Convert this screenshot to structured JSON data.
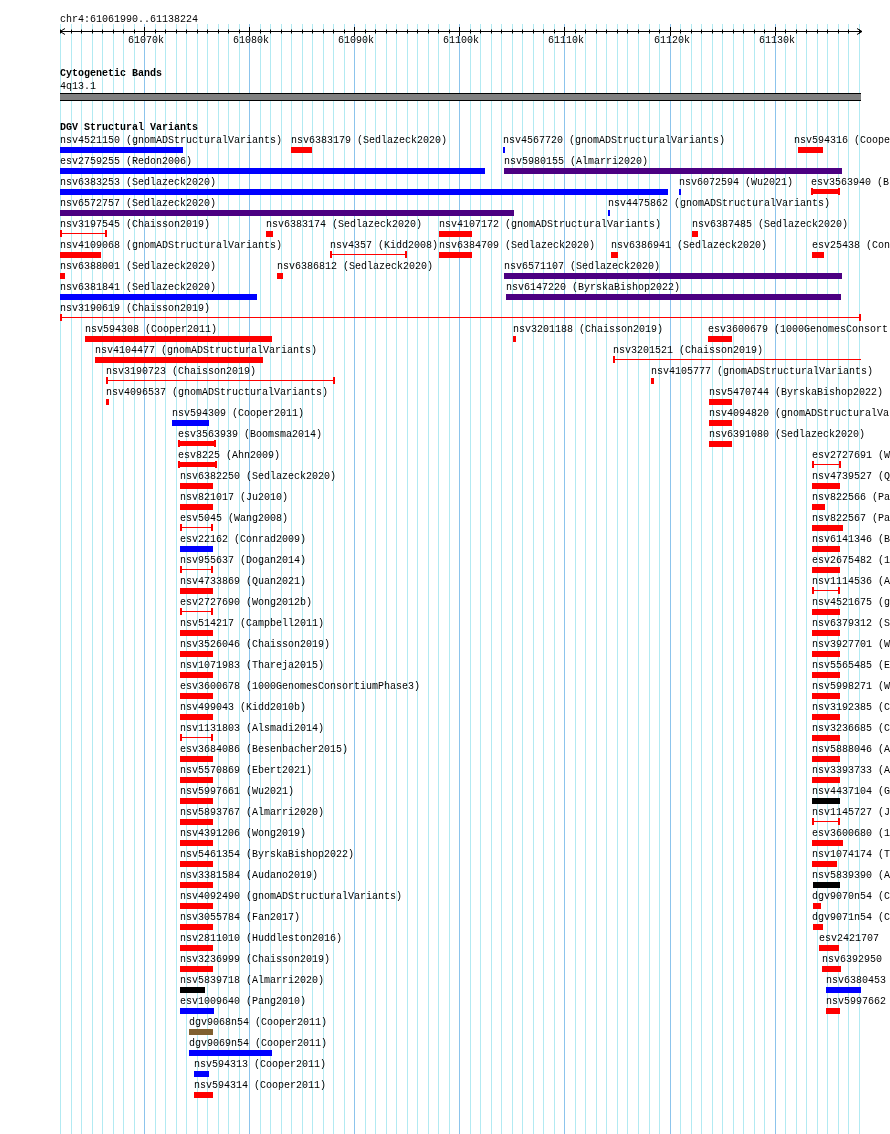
{
  "ruler": {
    "title": "chr4:61061990..61138224",
    "labels": [
      "61070k",
      "61080k",
      "61090k",
      "61100k",
      "61110k",
      "61120k",
      "61130k"
    ]
  },
  "tracks": [
    {
      "title": "Cytogenetic Bands",
      "band": {
        "label": "4q13.1"
      }
    },
    {
      "title": "DGV Structural Variants",
      "features": [
        {
          "label": "nsv4521150 (gnomADStructuralVariants)",
          "kind": "bar",
          "color": "#0000ff"
        },
        {
          "label": "nsv6383179 (Sedlazeck2020)",
          "kind": "bar",
          "color": "#ff0000"
        },
        {
          "label": "nsv4567720 (gnomADStructuralVariants)",
          "kind": "bar",
          "color": "#0000ff"
        },
        {
          "label": "nsv594316 (Coope",
          "kind": "bar",
          "color": "#ff0000"
        },
        {
          "label": "esv2759255 (Redon2006)",
          "kind": "bar",
          "color": "#0000ff"
        },
        {
          "label": "nsv5980155 (Almarri2020)",
          "kind": "bar",
          "color": "#4b0082"
        },
        {
          "label": "nsv6383253 (Sedlazeck2020)",
          "kind": "bar",
          "color": "#0000ff"
        },
        {
          "label": "nsv6072594 (Wu2021)",
          "kind": "bar",
          "color": "#0000ff"
        },
        {
          "label": "esv3563940 (B",
          "kind": "capped",
          "color": "#ff0000"
        },
        {
          "label": "nsv6572757 (Sedlazeck2020)",
          "kind": "bar",
          "color": "#4b0082"
        },
        {
          "label": "nsv4475862 (gnomADStructuralVariants)",
          "kind": "bar",
          "color": "#0000ff"
        },
        {
          "label": "nsv3197545 (Chaisson2019)",
          "kind": "span",
          "color": "#ff0000"
        },
        {
          "label": "nsv6383174 (Sedlazeck2020)",
          "kind": "bar",
          "color": "#ff0000"
        },
        {
          "label": "nsv4107172 (gnomADStructuralVariants)",
          "kind": "bar",
          "color": "#ff0000"
        },
        {
          "label": "nsv6387485 (Sedlazeck2020)",
          "kind": "bar",
          "color": "#ff0000"
        },
        {
          "label": "nsv4109068 (gnomADStructuralVariants)",
          "kind": "bar",
          "color": "#ff0000"
        },
        {
          "label": "nsv4357 (Kidd2008)",
          "kind": "span",
          "color": "#ff0000"
        },
        {
          "label": "nsv6384709 (Sedlazeck2020)",
          "kind": "bar",
          "color": "#ff0000"
        },
        {
          "label": "nsv6386941 (Sedlazeck2020)",
          "kind": "bar",
          "color": "#ff0000"
        },
        {
          "label": "esv25438 (Con",
          "kind": "bar",
          "color": "#ff0000"
        },
        {
          "label": "nsv6388001 (Sedlazeck2020)",
          "kind": "bar",
          "color": "#ff0000"
        },
        {
          "label": "nsv6386812 (Sedlazeck2020)",
          "kind": "bar",
          "color": "#ff0000"
        },
        {
          "label": "nsv6571107 (Sedlazeck2020)",
          "kind": "bar",
          "color": "#4b0082"
        },
        {
          "label": "nsv6381841 (Sedlazeck2020)",
          "kind": "bar",
          "color": "#0000ff"
        },
        {
          "label": "nsv6147220 (ByrskaBishop2022)",
          "kind": "bar",
          "color": "#4b0082"
        },
        {
          "label": "nsv3190619 (Chaisson2019)",
          "kind": "span",
          "color": "#ff0000"
        },
        {
          "label": "nsv594308 (Cooper2011)",
          "kind": "bar",
          "color": "#ff0000"
        },
        {
          "label": "nsv3201188 (Chaisson2019)",
          "kind": "bar",
          "color": "#ff0000"
        },
        {
          "label": "esv3600679 (1000GenomesConsort",
          "kind": "bar",
          "color": "#ff0000"
        },
        {
          "label": "nsv4104477 (gnomADStructuralVariants)",
          "kind": "bar",
          "color": "#ff0000"
        },
        {
          "label": "nsv3201521 (Chaisson2019)",
          "kind": "span",
          "color": "#ff0000"
        },
        {
          "label": "nsv3190723 (Chaisson2019)",
          "kind": "span",
          "color": "#ff0000"
        },
        {
          "label": "nsv4105777 (gnomADStructuralVariants)",
          "kind": "bar",
          "color": "#ff0000"
        },
        {
          "label": "nsv4096537 (gnomADStructuralVariants)",
          "kind": "bar",
          "color": "#ff0000"
        },
        {
          "label": "nsv5470744 (ByrskaBishop2022)",
          "kind": "bar",
          "color": "#ff0000"
        },
        {
          "label": "nsv594309 (Cooper2011)",
          "kind": "bar",
          "color": "#0000ff"
        },
        {
          "label": "nsv4094820 (gnomADStructuralVa",
          "kind": "bar",
          "color": "#ff0000"
        },
        {
          "label": "esv3563939 (Boomsma2014)",
          "kind": "capped",
          "color": "#ff0000"
        },
        {
          "label": "nsv6391080 (Sedlazeck2020)",
          "kind": "bar",
          "color": "#ff0000"
        },
        {
          "label": "esv8225 (Ahn2009)",
          "kind": "capped",
          "color": "#ff0000"
        },
        {
          "label": "esv2727691 (W",
          "kind": "span",
          "color": "#ff0000"
        },
        {
          "label": "nsv6382250 (Sedlazeck2020)",
          "kind": "bar",
          "color": "#ff0000"
        },
        {
          "label": "nsv4739527 (Q",
          "kind": "bar",
          "color": "#ff0000"
        },
        {
          "label": "nsv821017 (Ju2010)",
          "kind": "bar",
          "color": "#ff0000"
        },
        {
          "label": "nsv822566 (Pa",
          "kind": "bar",
          "color": "#ff0000"
        },
        {
          "label": "esv5045 (Wang2008)",
          "kind": "span",
          "color": "#ff0000"
        },
        {
          "label": "nsv822567 (Pa",
          "kind": "bar",
          "color": "#ff0000"
        },
        {
          "label": "esv22162 (Conrad2009)",
          "kind": "bar",
          "color": "#0000ff"
        },
        {
          "label": "nsv6141346 (B",
          "kind": "bar",
          "color": "#ff0000"
        },
        {
          "label": "nsv955637 (Dogan2014)",
          "kind": "span",
          "color": "#ff0000"
        },
        {
          "label": "esv2675482 (1",
          "kind": "bar",
          "color": "#ff0000"
        },
        {
          "label": "nsv4733869 (Quan2021)",
          "kind": "bar",
          "color": "#ff0000"
        },
        {
          "label": "nsv1114536 (A",
          "kind": "span",
          "color": "#ff0000"
        },
        {
          "label": "esv2727690 (Wong2012b)",
          "kind": "span",
          "color": "#ff0000"
        },
        {
          "label": "nsv4521675 (g",
          "kind": "bar",
          "color": "#ff0000"
        },
        {
          "label": "nsv514217 (Campbell2011)",
          "kind": "bar",
          "color": "#ff0000"
        },
        {
          "label": "nsv6379312 (S",
          "kind": "bar",
          "color": "#ff0000"
        },
        {
          "label": "nsv3526046 (Chaisson2019)",
          "kind": "bar",
          "color": "#ff0000"
        },
        {
          "label": "nsv3927701 (W",
          "kind": "bar",
          "color": "#ff0000"
        },
        {
          "label": "nsv1071983 (Thareja2015)",
          "kind": "bar",
          "color": "#ff0000"
        },
        {
          "label": "nsv5565485 (E",
          "kind": "bar",
          "color": "#ff0000"
        },
        {
          "label": "esv3600678 (1000GenomesConsortiumPhase3)",
          "kind": "bar",
          "color": "#ff0000"
        },
        {
          "label": "nsv5998271 (W",
          "kind": "bar",
          "color": "#ff0000"
        },
        {
          "label": "nsv499043 (Kidd2010b)",
          "kind": "bar",
          "color": "#ff0000"
        },
        {
          "label": "nsv3192385 (C",
          "kind": "bar",
          "color": "#ff0000"
        },
        {
          "label": "nsv1131803 (Alsmadi2014)",
          "kind": "span",
          "color": "#ff0000"
        },
        {
          "label": "nsv3236685 (C",
          "kind": "bar",
          "color": "#ff0000"
        },
        {
          "label": "esv3684086 (Besenbacher2015)",
          "kind": "bar",
          "color": "#ff0000"
        },
        {
          "label": "nsv5888046 (A",
          "kind": "bar",
          "color": "#ff0000"
        },
        {
          "label": "nsv5570869 (Ebert2021)",
          "kind": "bar",
          "color": "#ff0000"
        },
        {
          "label": "nsv3393733 (A",
          "kind": "bar",
          "color": "#ff0000"
        },
        {
          "label": "nsv5997661 (Wu2021)",
          "kind": "bar",
          "color": "#ff0000"
        },
        {
          "label": "nsv4437104 (G",
          "kind": "bar",
          "color": "#000000"
        },
        {
          "label": "nsv5893767 (Almarri2020)",
          "kind": "bar",
          "color": "#ff0000"
        },
        {
          "label": "nsv1145727 (J",
          "kind": "span",
          "color": "#ff0000"
        },
        {
          "label": "nsv4391206 (Wong2019)",
          "kind": "bar",
          "color": "#ff0000"
        },
        {
          "label": "esv3600680 (1",
          "kind": "bar",
          "color": "#ff0000"
        },
        {
          "label": "nsv5461354 (ByrskaBishop2022)",
          "kind": "bar",
          "color": "#ff0000"
        },
        {
          "label": "nsv1074174 (T",
          "kind": "bar",
          "color": "#ff0000"
        },
        {
          "label": "nsv3381584 (Audano2019)",
          "kind": "bar",
          "color": "#ff0000"
        },
        {
          "label": "nsv5839390 (A",
          "kind": "bar",
          "color": "#000000"
        },
        {
          "label": "nsv4092490 (gnomADStructuralVariants)",
          "kind": "bar",
          "color": "#ff0000"
        },
        {
          "label": "dgv9070n54 (C",
          "kind": "bar",
          "color": "#ff0000"
        },
        {
          "label": "nsv3055784 (Fan2017)",
          "kind": "bar",
          "color": "#ff0000"
        },
        {
          "label": "dgv9071n54 (C",
          "kind": "bar",
          "color": "#ff0000"
        },
        {
          "label": "nsv2811010 (Huddleston2016)",
          "kind": "bar",
          "color": "#ff0000"
        },
        {
          "label": "esv2421707",
          "kind": "bar",
          "color": "#ff0000"
        },
        {
          "label": "nsv3236999 (Chaisson2019)",
          "kind": "bar",
          "color": "#ff0000"
        },
        {
          "label": "nsv6392950",
          "kind": "bar",
          "color": "#ff0000"
        },
        {
          "label": "nsv5839718 (Almarri2020)",
          "kind": "bar",
          "color": "#000000"
        },
        {
          "label": "nsv6380453",
          "kind": "bar",
          "color": "#0000ff"
        },
        {
          "label": "esv1009640 (Pang2010)",
          "kind": "bar",
          "color": "#0000ff"
        },
        {
          "label": "nsv5997662",
          "kind": "bar",
          "color": "#ff0000"
        },
        {
          "label": "dgv9068n54 (Cooper2011)",
          "kind": "bar",
          "color": "#806030"
        },
        {
          "label": "dgv9069n54 (Cooper2011)",
          "kind": "bar",
          "color": "#0000ff"
        },
        {
          "label": "nsv594313 (Cooper2011)",
          "kind": "bar",
          "color": "#0000ff"
        },
        {
          "label": "nsv594314 (Cooper2011)",
          "kind": "bar",
          "color": "#ff0000"
        }
      ]
    }
  ]
}
